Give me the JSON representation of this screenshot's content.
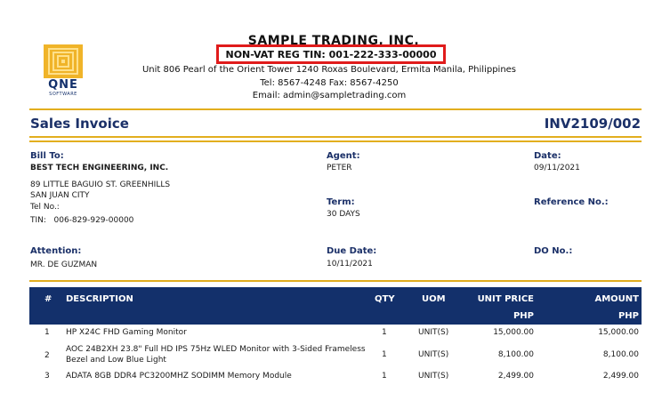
{
  "company": {
    "name": "SAMPLE TRADING, INC.",
    "tin_label": "NON-VAT REG TIN: 001-222-333-00000",
    "address": "Unit 806 Pearl of the Orient Tower 1240 Roxas Boulevard, Ermita Manila, Philippines",
    "contact": "Tel: 8567-4248  Fax: 8567-4250",
    "email": "Email: admin@sampletrading.com",
    "logo_text": "QNE",
    "logo_subtext": "SOFTWARE"
  },
  "document": {
    "title": "Sales Invoice",
    "number": "INV2109/002"
  },
  "bill_to": {
    "label": "Bill To:",
    "name": "BEST TECH ENGINEERING, INC.",
    "address_line1": "89 LITTLE BAGUIO ST. GREENHILLS",
    "address_line2": "SAN JUAN CITY",
    "tel": "Tel No.:",
    "tin": "TIN:   006-829-929-00000"
  },
  "agent": {
    "label": "Agent:",
    "value": "PETER"
  },
  "term": {
    "label": "Term:",
    "value": "30 DAYS"
  },
  "date": {
    "label": "Date:",
    "value": "09/11/2021"
  },
  "reference": {
    "label": "Reference No.:",
    "value": ""
  },
  "attention": {
    "label": "Attention:",
    "value": "MR. DE GUZMAN"
  },
  "due_date": {
    "label": "Due Date:",
    "value": "10/11/2021"
  },
  "do_no": {
    "label": "DO No.:",
    "value": ""
  },
  "table": {
    "headers": {
      "no": "#",
      "description": "DESCRIPTION",
      "qty": "QTY",
      "uom": "UOM",
      "unit_price": "UNIT PRICE",
      "unit_price_currency": "PHP",
      "amount": "AMOUNT",
      "amount_currency": "PHP"
    },
    "rows": [
      {
        "no": "1",
        "description": "HP X24C FHD Gaming Monitor",
        "description2": "",
        "qty": "1",
        "uom": "UNIT(S)",
        "unit_price": "15,000.00",
        "amount": "15,000.00"
      },
      {
        "no": "2",
        "description": "AOC 24B2XH 23.8\" Full HD IPS 75Hz WLED Monitor with 3-Sided Frameless",
        "description2": "Bezel and Low Blue Light",
        "qty": "1",
        "uom": "UNIT(S)",
        "unit_price": "8,100.00",
        "amount": "8,100.00"
      },
      {
        "no": "3",
        "description": "ADATA 8GB DDR4 PC3200MHZ SODIMM Memory Module",
        "description2": "",
        "qty": "1",
        "uom": "UNIT(S)",
        "unit_price": "2,499.00",
        "amount": "2,499.00"
      }
    ]
  },
  "colors": {
    "brand_navy": "#13306b",
    "accent_gold": "#e2ae1e",
    "highlight_red": "#e01b1b"
  }
}
